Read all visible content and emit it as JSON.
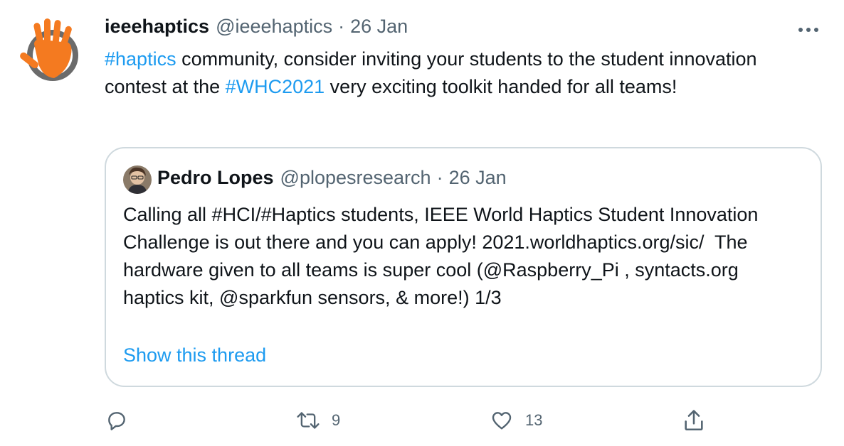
{
  "tweet": {
    "author": {
      "name": "ieeehaptics",
      "handle": "@ieeehaptics",
      "separator": "·",
      "date": "26 Jan"
    },
    "more_icon": "more-horizontal-icon",
    "text_segments": [
      {
        "text": "#haptics",
        "type": "hashtag"
      },
      {
        "text": " community, consider inviting your students to the student innovation contest at the ",
        "type": "text"
      },
      {
        "text": "#WHC2021",
        "type": "hashtag"
      },
      {
        "text": " very exciting toolkit handed for all teams!",
        "type": "text"
      }
    ],
    "colors": {
      "link": "#1d9bf0",
      "text": "#0f1419",
      "muted": "#536471",
      "border": "#cfd9de",
      "hand_orange": "#f47a20"
    }
  },
  "quote": {
    "author": {
      "name": "Pedro Lopes",
      "handle": "@plopesresearch",
      "separator": "·",
      "date": "26 Jan"
    },
    "text": "Calling all #HCI/#Haptics students, IEEE World Haptics Student Innovation Challenge is out there and you can apply! 2021.worldhaptics.org/sic/  The hardware given to all teams is super cool (@Raspberry_Pi , syntacts.org haptics kit, @sparkfun sensors, & more!) 1/3",
    "show_thread": "Show this thread"
  },
  "actions": {
    "reply": {
      "icon": "reply-icon",
      "count": ""
    },
    "retweet": {
      "icon": "retweet-icon",
      "count": "9"
    },
    "like": {
      "icon": "heart-icon",
      "count": "13"
    },
    "share": {
      "icon": "share-icon",
      "count": ""
    }
  }
}
